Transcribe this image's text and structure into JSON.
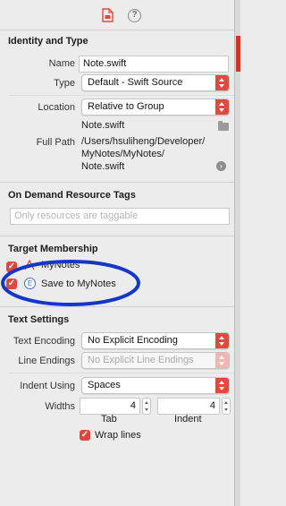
{
  "tabs": {
    "file": "file-inspector-tab",
    "help": "?"
  },
  "identity": {
    "header": "Identity and Type",
    "name_label": "Name",
    "name_value": "Note.swift",
    "type_label": "Type",
    "type_value": "Default - Swift Source",
    "location_label": "Location",
    "location_value": "Relative to Group",
    "location_file": "Note.swift",
    "fullpath_label": "Full Path",
    "fullpath_line1": "/Users/hsuliheng/Developer/",
    "fullpath_line2": "MyNotes/MyNotes/",
    "fullpath_line3": "Note.swift"
  },
  "on_demand": {
    "header": "On Demand Resource Tags",
    "placeholder": "Only resources are taggable"
  },
  "target_membership": {
    "header": "Target Membership",
    "items": [
      {
        "label": "MyNotes",
        "checked": true,
        "icon": "app-target-icon"
      },
      {
        "label": "Save to MyNotes",
        "checked": true,
        "icon": "extension-target-icon",
        "icon_glyph": "E"
      }
    ]
  },
  "text_settings": {
    "header": "Text Settings",
    "encoding_label": "Text Encoding",
    "encoding_value": "No Explicit Encoding",
    "line_endings_label": "Line Endings",
    "line_endings_value": "No Explicit Line Endings",
    "indent_label": "Indent Using",
    "indent_value": "Spaces",
    "widths_label": "Widths",
    "tab_width": "4",
    "indent_width": "4",
    "tab_caption": "Tab",
    "indent_caption": "Indent",
    "wrap_label": "Wrap lines",
    "wrap_checked": true
  },
  "colors": {
    "accent": "#e2483d",
    "annotation": "#1437c8"
  }
}
